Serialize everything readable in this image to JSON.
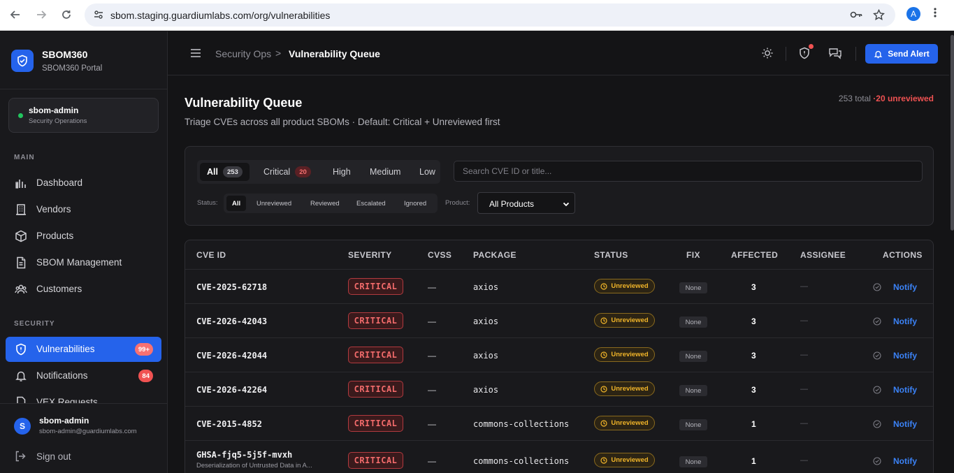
{
  "browser": {
    "url": "sbom.staging.guardiumlabs.com/org/vulnerabilities",
    "profile_initial": "A"
  },
  "brand": {
    "name": "SBOM360",
    "subtitle": "SBOM360 Portal"
  },
  "org": {
    "name": "sbom-admin",
    "role": "Security Operations",
    "status_color": "#22c55e"
  },
  "sidebar": {
    "main_label": "MAIN",
    "main_items": [
      {
        "label": "Dashboard",
        "icon": "bar-chart-icon"
      },
      {
        "label": "Vendors",
        "icon": "building-icon"
      },
      {
        "label": "Products",
        "icon": "box-icon"
      },
      {
        "label": "SBOM Management",
        "icon": "document-icon"
      },
      {
        "label": "Customers",
        "icon": "users-icon"
      }
    ],
    "security_label": "SECURITY",
    "security_items": [
      {
        "label": "Vulnerabilities",
        "icon": "shield-icon",
        "badge": "99+",
        "active": true
      },
      {
        "label": "Notifications",
        "icon": "bell-icon",
        "badge": "84",
        "active": false
      },
      {
        "label": "VEX Requests",
        "icon": "file-icon"
      }
    ]
  },
  "user": {
    "initial": "S",
    "name": "sbom-admin",
    "email": "sbom-admin@guardiumlabs.com",
    "signout_label": "Sign out"
  },
  "topbar": {
    "breadcrumb_parent": "Security Ops",
    "breadcrumb_sep": ">",
    "breadcrumb_current": "Vulnerability Queue",
    "send_alert_label": "Send Alert",
    "accent": "#2563eb"
  },
  "page": {
    "title": "Vulnerability Queue",
    "subtitle": "Triage CVEs across all product SBOMs · Default: Critical + Unreviewed first",
    "total_text": "253 total",
    "unreviewed_text": "·20 unreviewed"
  },
  "filters": {
    "severity_tabs": [
      {
        "label": "All",
        "count": "253",
        "active": true
      },
      {
        "label": "Critical",
        "count": "20",
        "active": false
      },
      {
        "label": "High",
        "count": null,
        "active": false
      },
      {
        "label": "Medium",
        "count": null,
        "active": false
      },
      {
        "label": "Low",
        "count": null,
        "active": false
      }
    ],
    "search_placeholder": "Search CVE ID or title...",
    "status_label": "Status:",
    "status_tabs": [
      {
        "label": "All",
        "active": true
      },
      {
        "label": "Unreviewed",
        "active": false
      },
      {
        "label": "Reviewed",
        "active": false
      },
      {
        "label": "Escalated",
        "active": false
      },
      {
        "label": "Ignored",
        "active": false
      }
    ],
    "product_label": "Product:",
    "product_value": "All Products"
  },
  "table": {
    "headers": [
      "CVE ID",
      "SEVERITY",
      "CVSS",
      "PACKAGE",
      "STATUS",
      "FIX",
      "AFFECTED",
      "ASSIGNEE",
      "ACTIONS"
    ],
    "rows": [
      {
        "cve": "CVE-2025-62718",
        "desc": "",
        "severity": "CRITICAL",
        "cvss": "—",
        "package": "axios",
        "status": "Unreviewed",
        "fix": "None",
        "affected": "3",
        "assignee": "—",
        "action": "Notify"
      },
      {
        "cve": "CVE-2026-42043",
        "desc": "",
        "severity": "CRITICAL",
        "cvss": "—",
        "package": "axios",
        "status": "Unreviewed",
        "fix": "None",
        "affected": "3",
        "assignee": "—",
        "action": "Notify"
      },
      {
        "cve": "CVE-2026-42044",
        "desc": "",
        "severity": "CRITICAL",
        "cvss": "—",
        "package": "axios",
        "status": "Unreviewed",
        "fix": "None",
        "affected": "3",
        "assignee": "—",
        "action": "Notify"
      },
      {
        "cve": "CVE-2026-42264",
        "desc": "",
        "severity": "CRITICAL",
        "cvss": "—",
        "package": "axios",
        "status": "Unreviewed",
        "fix": "None",
        "affected": "3",
        "assignee": "—",
        "action": "Notify"
      },
      {
        "cve": "CVE-2015-4852",
        "desc": "",
        "severity": "CRITICAL",
        "cvss": "—",
        "package": "commons-collections",
        "status": "Unreviewed",
        "fix": "None",
        "affected": "1",
        "assignee": "—",
        "action": "Notify"
      },
      {
        "cve": "GHSA-fjq5-5j5f-mvxh",
        "desc": "Deserialization of Untrusted Data in A...",
        "severity": "CRITICAL",
        "cvss": "—",
        "package": "commons-collections",
        "status": "Unreviewed",
        "fix": "None",
        "affected": "1",
        "assignee": "—",
        "action": "Notify"
      }
    ]
  }
}
